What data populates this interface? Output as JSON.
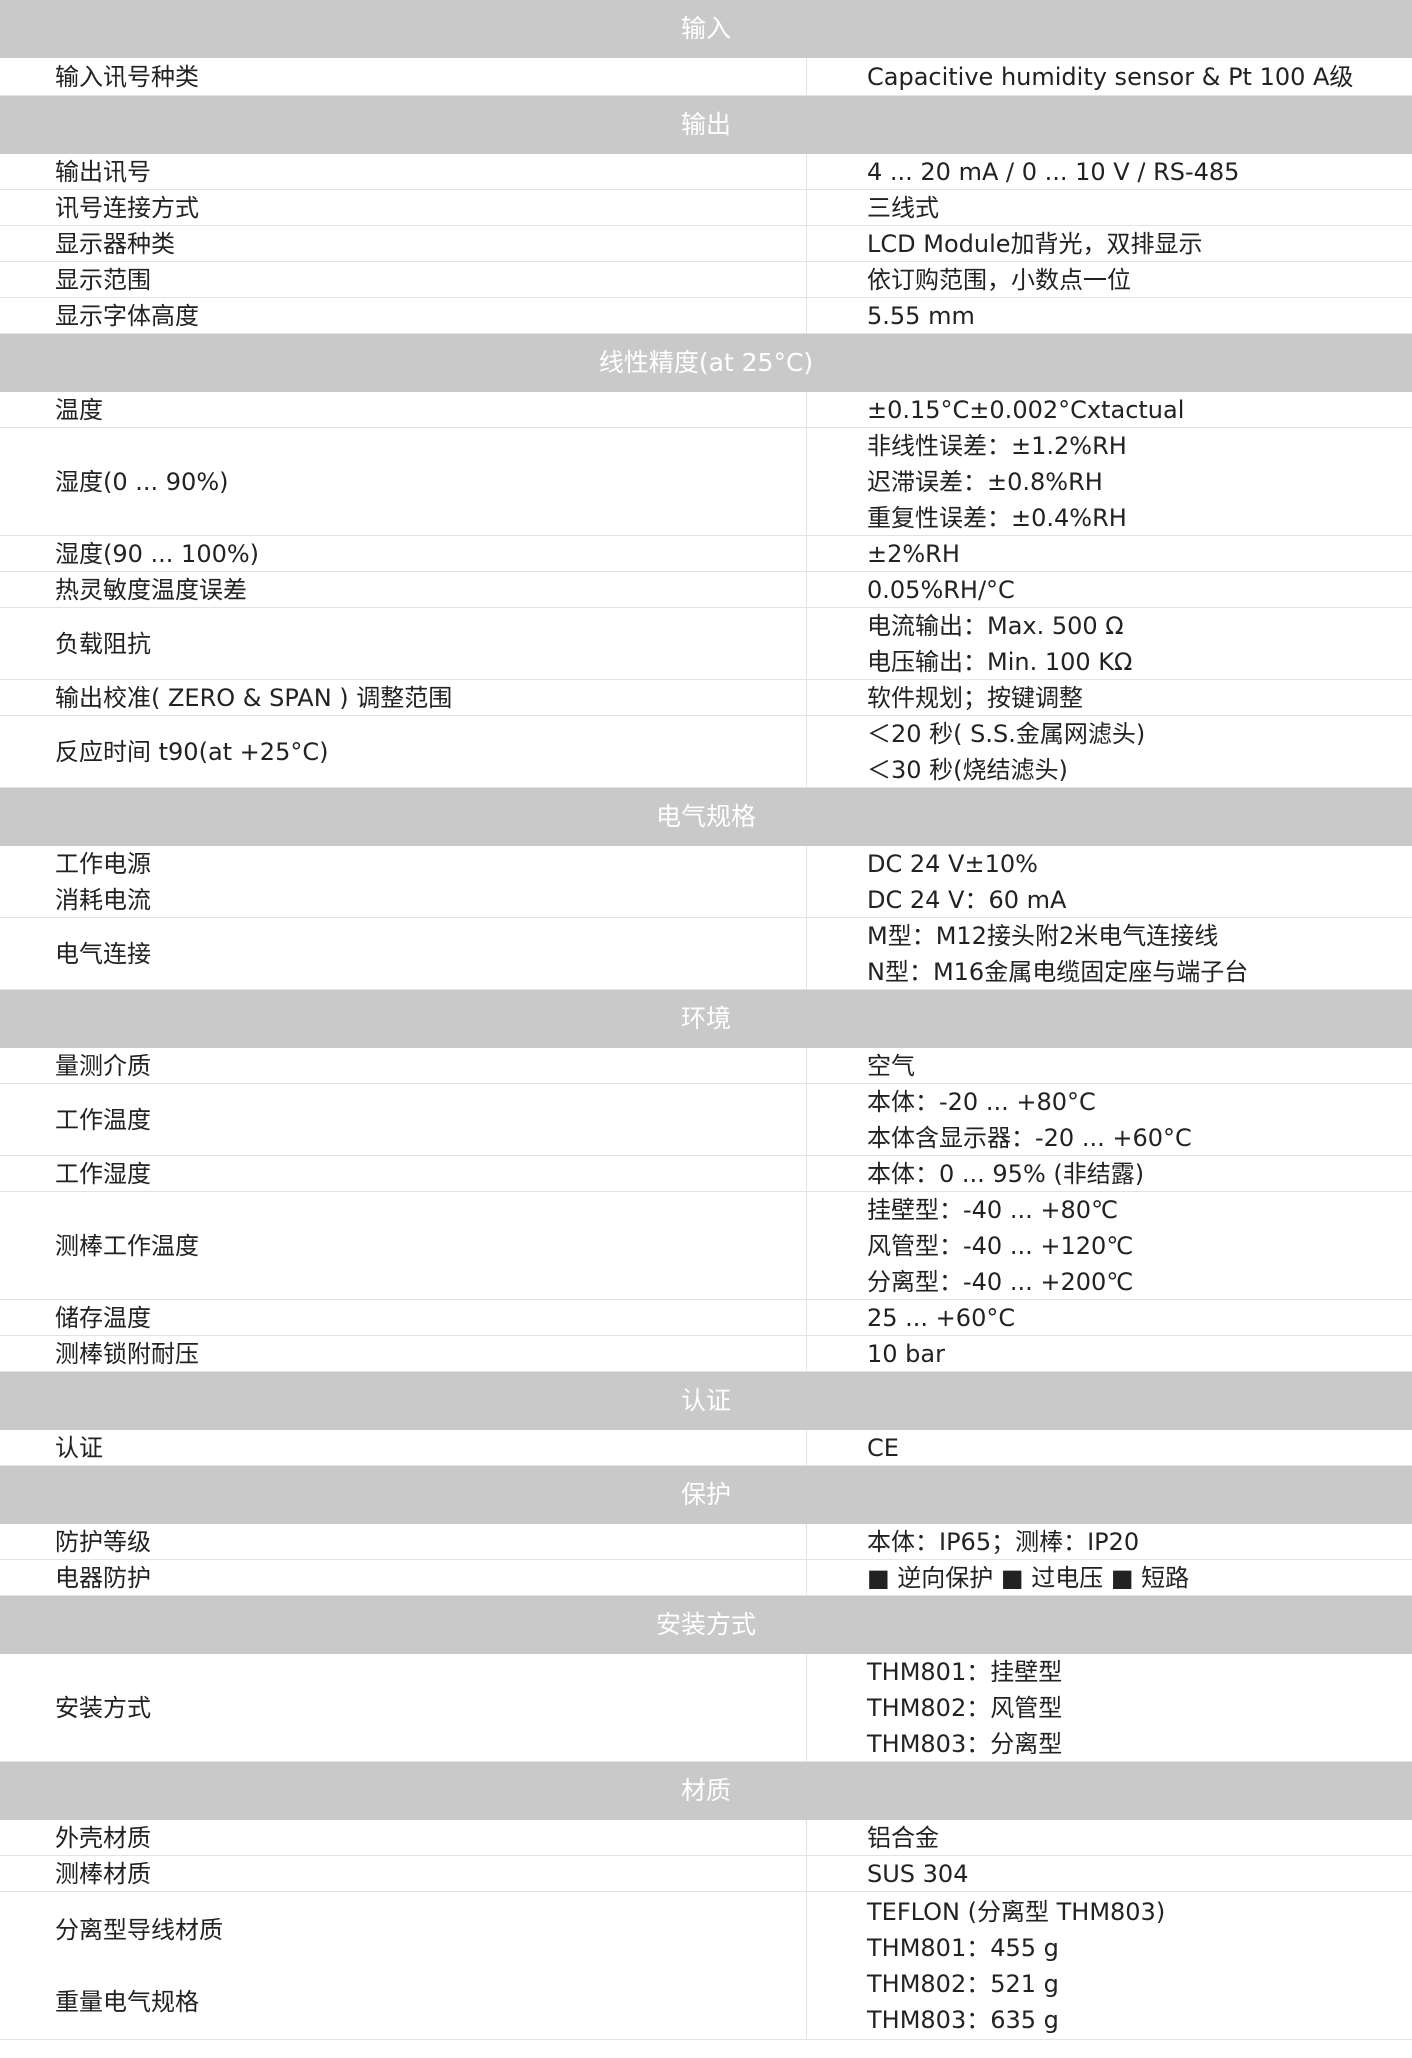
{
  "sections": [
    {
      "title": "输入",
      "rows": [
        {
          "label": [
            "输入讯号种类"
          ],
          "value": [
            "Capacitive humidity sensor & Pt 100 A级"
          ],
          "h": 38
        }
      ]
    },
    {
      "title": "输出",
      "rows": [
        {
          "label": [
            "输出讯号"
          ],
          "value": [
            "4 ... 20 mA / 0 ... 10 V / RS-485"
          ],
          "h": 36
        },
        {
          "label": [
            "讯号连接方式"
          ],
          "value": [
            "三线式"
          ],
          "h": 36
        },
        {
          "label": [
            "显示器种类"
          ],
          "value": [
            "LCD Module加背光，双排显示"
          ],
          "h": 36
        },
        {
          "label": [
            "显示范围"
          ],
          "value": [
            "依订购范围，小数点一位"
          ],
          "h": 36
        },
        {
          "label": [
            "显示字体高度"
          ],
          "value": [
            "5.55 mm"
          ],
          "h": 36
        }
      ]
    },
    {
      "title": "线性精度(at 25°C)",
      "rows": [
        {
          "label": [
            "温度"
          ],
          "value": [
            "±0.15°C±0.002°Cxtactual"
          ],
          "h": 36
        },
        {
          "label": [
            "湿度(0 ... 90%)"
          ],
          "value": [
            "非线性误差：±1.2%RH",
            "迟滞误差：±0.8%RH",
            "重复性误差：±0.4%RH"
          ],
          "h": 108
        },
        {
          "label": [
            "湿度(90 ... 100%)"
          ],
          "value": [
            "±2%RH"
          ],
          "h": 36
        },
        {
          "label": [
            "热灵敏度温度误差"
          ],
          "value": [
            "0.05%RH/°C"
          ],
          "h": 36
        },
        {
          "label": [
            "负载阻抗"
          ],
          "value": [
            "电流输出：Max. 500 Ω",
            "电压输出：Min. 100 KΩ"
          ],
          "h": 72
        },
        {
          "label": [
            "输出校准( ZERO & SPAN ) 调整范围"
          ],
          "value": [
            "软件规划；按键调整"
          ],
          "h": 36
        },
        {
          "label": [
            "反应时间 t90(at +25°C)"
          ],
          "value": [
            "＜20 秒( S.S.金属网滤头)",
            "＜30 秒(烧结滤头)"
          ],
          "h": 72
        }
      ]
    },
    {
      "title": "电气规格",
      "rows": [
        {
          "label": [
            "工作电源",
            "消耗电流"
          ],
          "value": [
            "DC 24 V±10%",
            "DC 24 V：60 mA"
          ],
          "h": 72
        },
        {
          "label": [
            "电气连接"
          ],
          "value": [
            "M型：M12接头附2米电气连接线",
            "N型：M16金属电缆固定座与端子台"
          ],
          "h": 72
        }
      ]
    },
    {
      "title": "环境",
      "rows": [
        {
          "label": [
            "量测介质"
          ],
          "value": [
            "空气"
          ],
          "h": 36
        },
        {
          "label": [
            "工作温度"
          ],
          "value": [
            "本体：-20 ... +80°C",
            "本体含显示器：-20 ... +60°C"
          ],
          "h": 72
        },
        {
          "label": [
            "工作湿度"
          ],
          "value": [
            "本体：0 ... 95% (非结露)"
          ],
          "h": 36
        },
        {
          "label": [
            "测棒工作温度"
          ],
          "value": [
            "挂壁型：-40 ... +80℃",
            "风管型：-40 ... +120℃",
            "分离型：-40 ... +200℃"
          ],
          "h": 108
        },
        {
          "label": [
            "储存温度"
          ],
          "value": [
            "25 ... +60°C"
          ],
          "h": 36
        },
        {
          "label": [
            "测棒锁附耐压"
          ],
          "value": [
            "10 bar"
          ],
          "h": 36
        }
      ]
    },
    {
      "title": "认证",
      "rows": [
        {
          "label": [
            "认证"
          ],
          "value": [
            "CE"
          ],
          "h": 36
        }
      ]
    },
    {
      "title": "保护",
      "rows": [
        {
          "label": [
            "防护等级"
          ],
          "value": [
            "本体：IP65；测棒：IP20"
          ],
          "h": 36
        },
        {
          "label": [
            "电器防护"
          ],
          "value": [
            "■ 逆向保护 ■ 过电压 ■ 短路"
          ],
          "h": 36
        }
      ]
    },
    {
      "title": "安装方式",
      "rows": [
        {
          "label": [
            "安装方式"
          ],
          "value": [
            "THM801：挂壁型",
            "THM802：风管型",
            "THM803：分离型"
          ],
          "h": 108
        }
      ]
    },
    {
      "title": "材质",
      "rows": [
        {
          "label": [
            "外壳材质"
          ],
          "value": [
            "铝合金"
          ],
          "h": 36
        },
        {
          "label": [
            "测棒材质"
          ],
          "value": [
            "SUS 304"
          ],
          "h": 36
        },
        {
          "label": [
            "分离型导线材质",
            "",
            "重量电气规格"
          ],
          "value": [
            "TEFLON (分离型 THM803)",
            "THM801：455 g",
            "THM802：521 g",
            "THM803：635 g"
          ],
          "h": 148
        }
      ]
    }
  ]
}
